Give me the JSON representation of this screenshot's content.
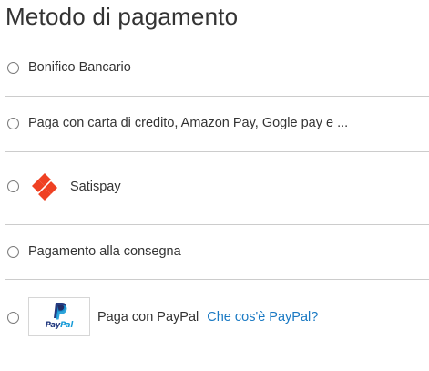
{
  "section_title": "Metodo di pagamento",
  "payment_methods": [
    {
      "label": "Bonifico Bancario"
    },
    {
      "label": "Paga con carta di credito, Amazon Pay, Gogle pay e ..."
    },
    {
      "label": "Satispay",
      "logo": "satispay-logo"
    },
    {
      "label": "Pagamento alla consegna"
    },
    {
      "label": "Paga con PayPal",
      "logo": "paypal-logo",
      "logo_text_1": "Pay",
      "logo_text_2": "Pal",
      "link_text": "Che cos'è PayPal?"
    }
  ],
  "colors": {
    "text": "#333333",
    "divider": "#cccccc",
    "link": "#1979c3",
    "satispay_red": "#ef4123",
    "paypal_dark": "#253b80",
    "paypal_light": "#179bd7"
  }
}
